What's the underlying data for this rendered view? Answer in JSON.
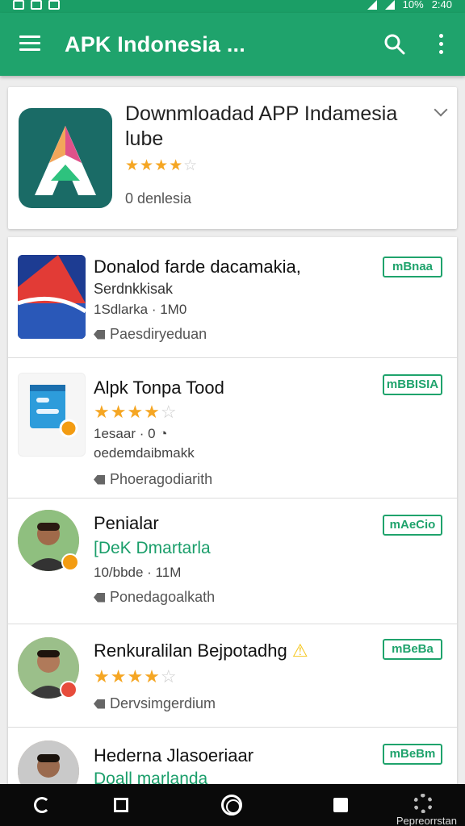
{
  "status_bar": {
    "battery_pct": "10%",
    "time": "2:40"
  },
  "app_bar": {
    "title": "APK Indonesia ..."
  },
  "featured": {
    "title": "Downmloadad APP Indamesia lube",
    "rating": 4,
    "rating_text": "★★★★★☆",
    "subtitle": "0  denlesia"
  },
  "list": [
    {
      "title": "Donalod farde dacamakia,",
      "line": "Serdnkkisak",
      "meta": "1Sdlarka · 1M0",
      "tag": "Paesdiryeduan",
      "button": "mBnaa"
    },
    {
      "title": "Alpk Tonpa Tood",
      "stars": 3.5,
      "meta1": "1esaar · 0",
      "meta2": "oedemdaibmakk",
      "tag": "Phoeragodiarith",
      "button": "mBBISIA"
    },
    {
      "title": "Penialar",
      "green": "[DeK Dmartarla",
      "meta": "10/bbde · 11M",
      "tag": "Ponedagoalkath",
      "button": "mAeCio"
    },
    {
      "title": "Renkuralilan Bejpotadhg",
      "stars": 3.5,
      "tag": "Dervsimgerdium",
      "button": "mBeBa"
    },
    {
      "title": "Hederna Jlasoeriaar",
      "green": "Doall marlanda",
      "button": "mBeBm"
    }
  ],
  "nav": {
    "settings_label": "Pepreorrstan"
  },
  "colors": {
    "primary": "#1fa36c",
    "status": "#1b9e66",
    "star": "#f5a623"
  }
}
